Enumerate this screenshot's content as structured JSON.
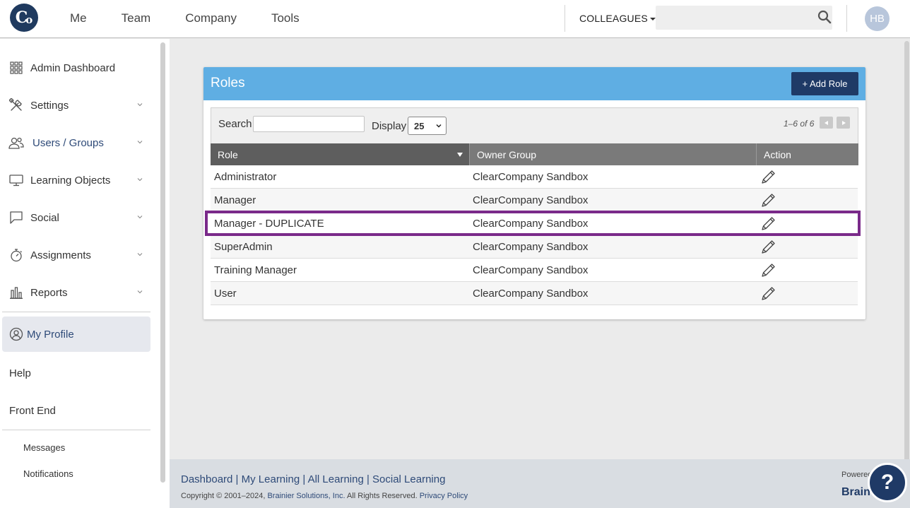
{
  "topnav": {
    "logo_letter": "C",
    "logo_letter2": "o",
    "links": [
      "Me",
      "Team",
      "Company",
      "Tools"
    ],
    "colleagues_label": "COLLEAGUES",
    "search_placeholder": "",
    "avatar_initials": "HB"
  },
  "sidebar": {
    "items": [
      {
        "label": "Admin Dashboard",
        "icon": "grid-icon"
      },
      {
        "label": "Settings",
        "icon": "tools-icon"
      },
      {
        "label": "Users / Groups",
        "icon": "users-icon"
      },
      {
        "label": "Learning Objects",
        "icon": "monitor-icon"
      },
      {
        "label": "Social",
        "icon": "chat-icon"
      },
      {
        "label": "Assignments",
        "icon": "stopwatch-icon"
      },
      {
        "label": "Reports",
        "icon": "bar-chart-icon"
      }
    ],
    "profile_label": "My Profile",
    "help_label": "Help",
    "frontend_label": "Front End",
    "messages_label": "Messages",
    "notifications_label": "Notifications"
  },
  "panel": {
    "title": "Roles",
    "add_button": "+ Add Role",
    "search_label": "Search",
    "search_value": "",
    "display_label": "Display",
    "display_value": "25",
    "pager_text": "1–6 of 6",
    "columns": {
      "role": "Role",
      "owner": "Owner Group",
      "action": "Action"
    },
    "rows": [
      {
        "role": "Administrator",
        "owner": "ClearCompany Sandbox"
      },
      {
        "role": "Manager",
        "owner": "ClearCompany Sandbox"
      },
      {
        "role": "Manager - DUPLICATE",
        "owner": "ClearCompany Sandbox"
      },
      {
        "role": "SuperAdmin",
        "owner": "ClearCompany Sandbox"
      },
      {
        "role": "Training Manager",
        "owner": "ClearCompany Sandbox"
      },
      {
        "role": "User",
        "owner": "ClearCompany Sandbox"
      }
    ],
    "highlight_color": "#7a2a8a"
  },
  "footer": {
    "links": [
      "Dashboard",
      "My Learning",
      "All Learning",
      "Social Learning"
    ],
    "copyright": "Copyright © 2001–2024, ",
    "company": "Brainier Solutions, Inc.",
    "rights": " All Rights Reserved. ",
    "privacy": "Privacy Policy",
    "powered": "Powered",
    "brand": "Brain"
  },
  "help_button": "?",
  "colors": {
    "header_blue": "#5faee3",
    "navy": "#1f3a66",
    "accent_text": "#2e4a78"
  }
}
